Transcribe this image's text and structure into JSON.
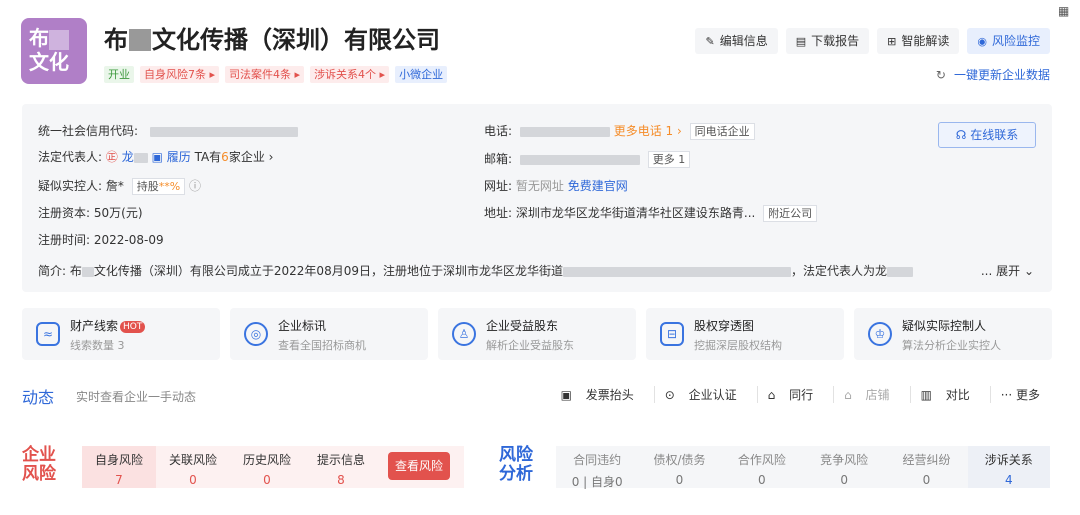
{
  "company": {
    "logo_text_1": "布",
    "logo_text_2": "文化",
    "name_prefix": "布",
    "name_suffix": "文化传播（深圳）有限公司",
    "tags": [
      "开业",
      "自身风险7条 ▸",
      "司法案件4条 ▸",
      "涉诉关系4个 ▸",
      "小微企业"
    ]
  },
  "actions": {
    "edit": "编辑信息",
    "download": "下载报告",
    "ai": "智能解读",
    "monitor": "风险监控",
    "refresh": "一键更新企业数据"
  },
  "info": {
    "credit_code_label": "统一社会信用代码:",
    "legal_rep_label": "法定代表人:",
    "legal_rep_name": "龙",
    "resume": "履历",
    "ta_has": "TA有",
    "ta_count": "6",
    "ta_suffix": "家企业 ›",
    "controller_label": "疑似实控人:",
    "controller_name": "詹*",
    "holding": "持股",
    "holding_pct": "**%",
    "capital_label": "注册资本:",
    "capital_value": "50万(元)",
    "date_label": "注册时间:",
    "date_value": "2022-08-09",
    "phone_label": "电话:",
    "more_phone": "更多电话 1 ›",
    "same_phone": "同电话企业",
    "email_label": "邮箱:",
    "more_email": "更多 1",
    "web_label": "网址:",
    "web_none": "暂无网址",
    "web_build": "免费建官网",
    "addr_label": "地址:",
    "addr_value": "深圳市龙华区龙华街道清华社区建设东路青...",
    "nearby": "附近公司",
    "online": "在线联系",
    "intro_label": "简介:",
    "intro_1": "布",
    "intro_2": "文化传播（深圳）有限公司成立于2022年08月09日，注册地位于深圳市龙华区龙华街道",
    "intro_3": "，法定代表人为龙",
    "expand": "... 展开"
  },
  "cards": [
    {
      "title": "财产线索",
      "sub": "线索数量 3",
      "icon": "wallet-icon",
      "hot": "HOT"
    },
    {
      "title": "企业标讯",
      "sub": "查看全国招标商机",
      "icon": "target-icon"
    },
    {
      "title": "企业受益股东",
      "sub": "解析企业受益股东",
      "icon": "person-icon"
    },
    {
      "title": "股权穿透图",
      "sub": "挖掘深层股权结构",
      "icon": "structure-icon"
    },
    {
      "title": "疑似实际控制人",
      "sub": "算法分析企业实控人",
      "icon": "controller-icon"
    }
  ],
  "dynamic": {
    "title": "动态",
    "sub": "实时查看企业一手动态"
  },
  "tools": [
    "发票抬头",
    "企业认证",
    "同行",
    "店铺",
    "对比",
    "··· 更多"
  ],
  "risk": {
    "title_1": "企业",
    "title_2": "风险",
    "items": [
      {
        "label": "自身风险",
        "value": "7"
      },
      {
        "label": "关联风险",
        "value": "0"
      },
      {
        "label": "历史风险",
        "value": "0"
      },
      {
        "label": "提示信息",
        "value": "8"
      }
    ],
    "button": "查看风险"
  },
  "analysis": {
    "title_1": "风险",
    "title_2": "分析",
    "items": [
      {
        "label": "合同违约",
        "value": "0 | 自身0"
      },
      {
        "label": "债权/债务",
        "value": "0"
      },
      {
        "label": "合作风险",
        "value": "0"
      },
      {
        "label": "竞争风险",
        "value": "0"
      },
      {
        "label": "经营纠纷",
        "value": "0"
      },
      {
        "label": "涉诉关系",
        "value": "4"
      }
    ]
  }
}
